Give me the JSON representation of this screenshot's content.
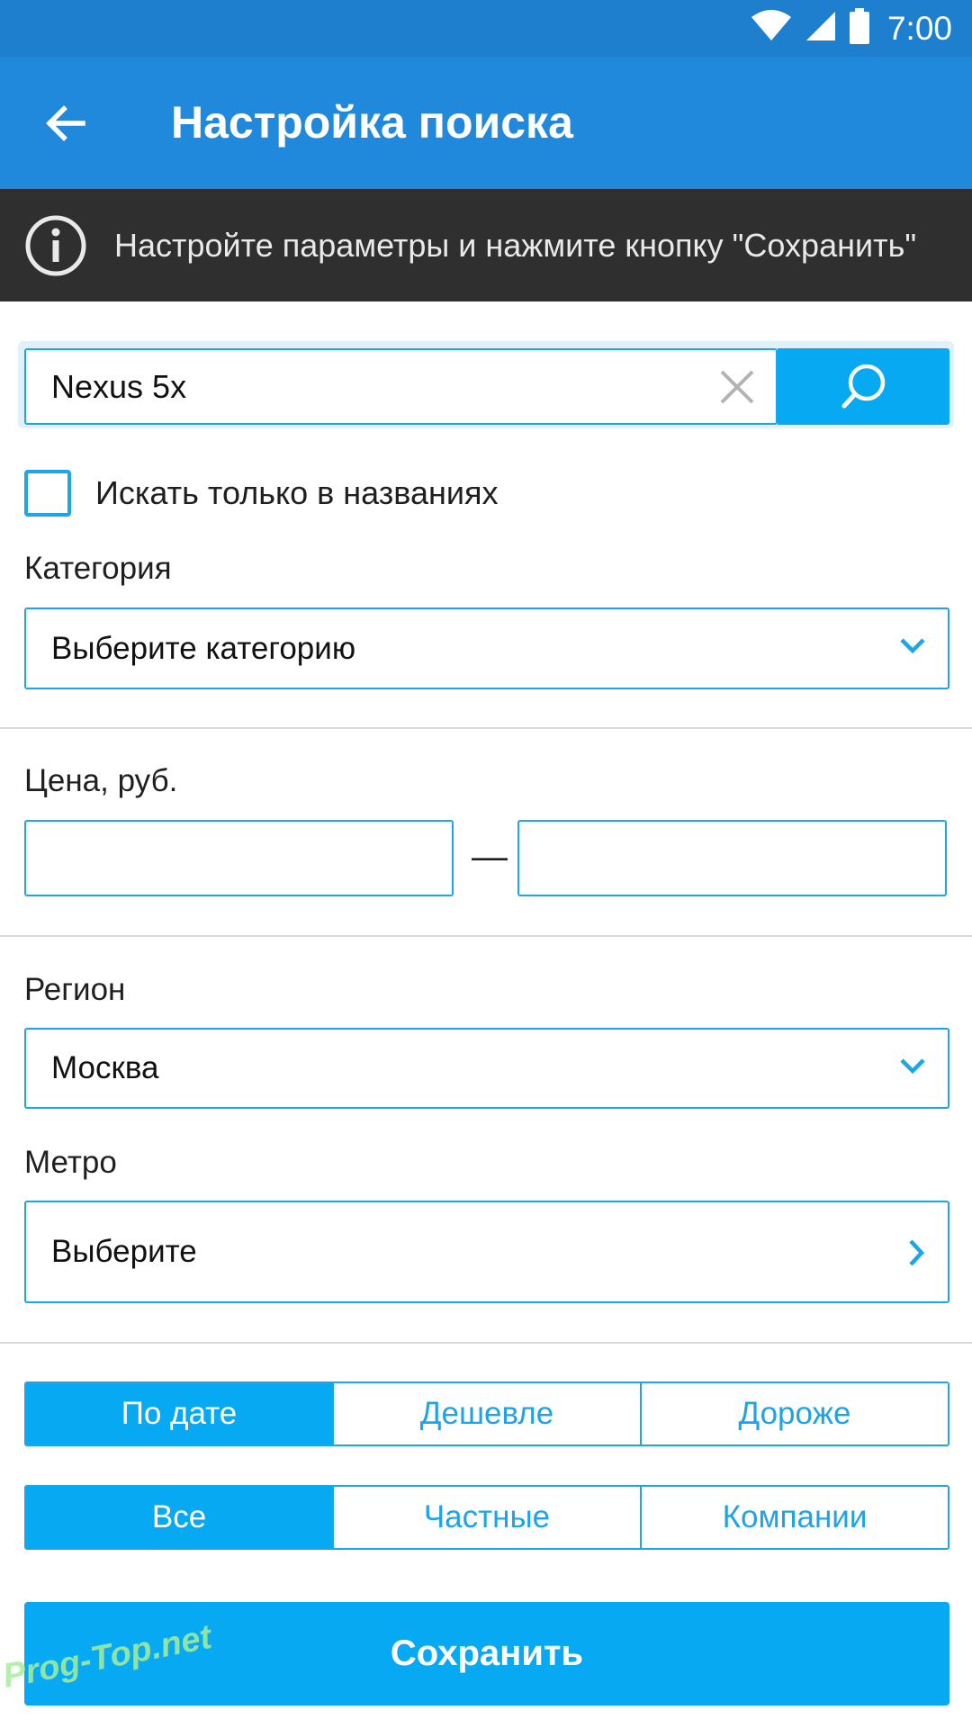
{
  "status_bar": {
    "time": "7:00",
    "icons": [
      "wifi-icon",
      "signal-icon",
      "battery-icon"
    ]
  },
  "app_bar": {
    "back_icon": "arrow-left-icon",
    "title": "Настройка поиска"
  },
  "info_banner": {
    "icon": "info-icon",
    "text": "Настройте параметры и нажмите кнопку \"Сохранить\""
  },
  "search": {
    "value": "Nexus 5x",
    "clear_icon": "close-icon",
    "button_icon": "search-icon"
  },
  "title_only": {
    "label": "Искать только в названиях",
    "checked": false
  },
  "category": {
    "label": "Категория",
    "value": "Выберите категорию"
  },
  "price": {
    "label": "Цена, руб.",
    "from": "",
    "to": "",
    "separator": "—"
  },
  "region": {
    "label": "Регион",
    "value": "Москва"
  },
  "metro": {
    "label": "Метро",
    "value": "Выберите"
  },
  "sort": {
    "options": [
      "По дате",
      "Дешевле",
      "Дороже"
    ],
    "selected": "По дате"
  },
  "seller_type": {
    "options": [
      "Все",
      "Частные",
      "Компании"
    ],
    "selected": "Все"
  },
  "save_label": "Сохранить",
  "watermark": "Prog-Top.net",
  "colors": {
    "status_bar": "#1e7fcf",
    "app_bar": "#2189dc",
    "info_bar": "#2f2f2f",
    "accent": "#07a9f3",
    "border": "#1aa6e8"
  }
}
